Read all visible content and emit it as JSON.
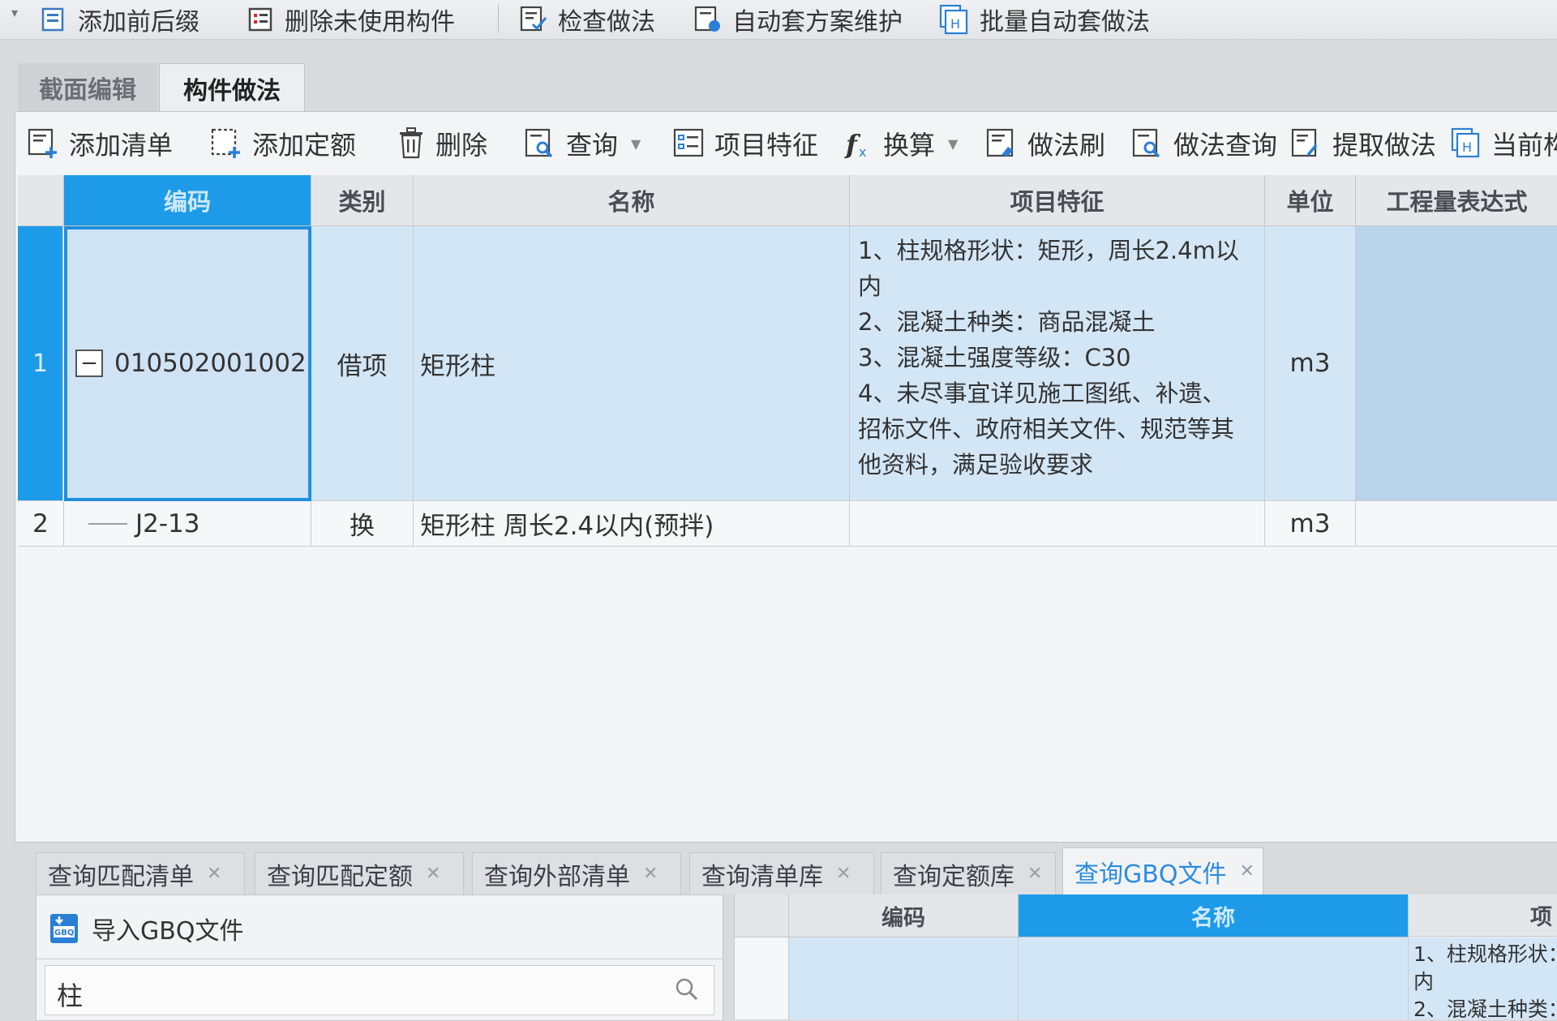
{
  "top_toolbar": {
    "items": [
      {
        "label": "添加前后缀",
        "icon": "add-prefix-icon"
      },
      {
        "label": "删除未使用构件",
        "icon": "delete-unused-icon"
      },
      {
        "label": "检查做法",
        "icon": "check-method-icon"
      },
      {
        "label": "自动套方案维护",
        "icon": "auto-scheme-icon"
      },
      {
        "label": "批量自动套做法",
        "icon": "batch-auto-icon"
      }
    ]
  },
  "section_tabs": [
    {
      "label": "截面编辑",
      "active": false
    },
    {
      "label": "构件做法",
      "active": true
    }
  ],
  "method_toolbar": {
    "items": [
      {
        "label": "添加清单",
        "icon": "add-list-icon"
      },
      {
        "label": "添加定额",
        "icon": "add-quota-icon"
      },
      {
        "label": "删除",
        "icon": "trash-icon"
      },
      {
        "label": "查询",
        "icon": "query-icon",
        "has_dropdown": true
      },
      {
        "label": "项目特征",
        "icon": "feature-icon"
      },
      {
        "label": "换算",
        "icon": "function-icon",
        "has_dropdown": true
      },
      {
        "label": "做法刷",
        "icon": "method-brush-icon"
      },
      {
        "label": "做法查询",
        "icon": "method-query-icon"
      },
      {
        "label": "提取做法",
        "icon": "extract-method-icon"
      },
      {
        "label": "当前构",
        "icon": "current-component-icon"
      }
    ]
  },
  "grid": {
    "columns": [
      "编码",
      "类别",
      "名称",
      "项目特征",
      "单位",
      "工程量表达式"
    ],
    "selected_column": "编码",
    "rows": [
      {
        "num": "1",
        "code": "010502001002",
        "category": "借项",
        "name": "矩形柱",
        "features": [
          "1、柱规格形状：矩形，周长2.4m以",
          "内",
          "2、混凝土种类：商品混凝土",
          "3、混凝土强度等级：C30",
          "4、未尽事宜详见施工图纸、补遗、",
          "招标文件、政府相关文件、规范等其",
          "他资料，满足验收要求"
        ],
        "unit": "m3",
        "expr": "",
        "selected": true,
        "collapse_symbol": "−"
      },
      {
        "num": "2",
        "code": "J2-13",
        "category": "换",
        "name": "矩形柱 周长2.4以内(预拌)",
        "features": [],
        "unit": "m3",
        "expr": "",
        "selected": false
      }
    ]
  },
  "query_tabs": [
    {
      "label": "查询匹配清单",
      "active": false
    },
    {
      "label": "查询匹配定额",
      "active": false
    },
    {
      "label": "查询外部清单",
      "active": false
    },
    {
      "label": "查询清单库",
      "active": false
    },
    {
      "label": "查询定额库",
      "active": false
    },
    {
      "label": "查询GBQ文件",
      "active": true
    }
  ],
  "gbq_panel": {
    "import_label": "导入GBQ文件",
    "search_value": "柱"
  },
  "result_grid": {
    "columns": [
      "编码",
      "名称",
      "项"
    ],
    "selected_column": "名称",
    "features_preview": [
      "1、柱规格形状：",
      "内",
      "2、混凝土种类："
    ]
  },
  "colors": {
    "accent": "#1e9be8",
    "selected_row": "#d3e6f6",
    "active_tab_text": "#2c8be0"
  }
}
